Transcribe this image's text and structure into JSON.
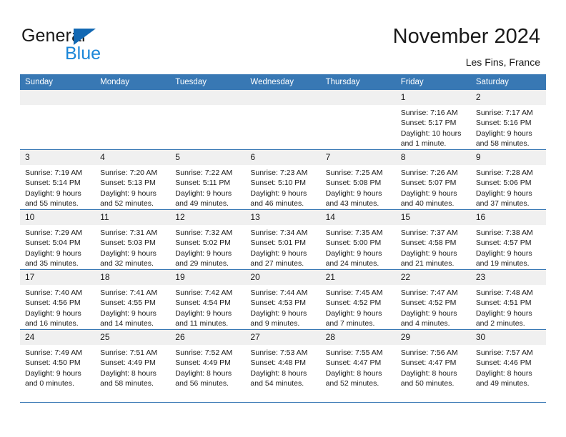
{
  "brand": {
    "name_part1": "General",
    "name_part2": "Blue",
    "triangle_color": "#1268b3",
    "blue_text_color": "#1a86d8"
  },
  "header": {
    "title": "November 2024",
    "subtitle": "Les Fins, France",
    "header_bg_color": "#3878b4",
    "daynum_bg_color": "#f0f0f0"
  },
  "weekday_headers": [
    "Sunday",
    "Monday",
    "Tuesday",
    "Wednesday",
    "Thursday",
    "Friday",
    "Saturday"
  ],
  "weeks": [
    [
      {
        "day": "",
        "empty": true,
        "sunrise": "",
        "sunset": "",
        "daylight_line1": "",
        "daylight_line2": ""
      },
      {
        "day": "",
        "empty": true,
        "sunrise": "",
        "sunset": "",
        "daylight_line1": "",
        "daylight_line2": ""
      },
      {
        "day": "",
        "empty": true,
        "sunrise": "",
        "sunset": "",
        "daylight_line1": "",
        "daylight_line2": ""
      },
      {
        "day": "",
        "empty": true,
        "sunrise": "",
        "sunset": "",
        "daylight_line1": "",
        "daylight_line2": ""
      },
      {
        "day": "",
        "empty": true,
        "sunrise": "",
        "sunset": "",
        "daylight_line1": "",
        "daylight_line2": ""
      },
      {
        "day": "1",
        "sunrise": "Sunrise: 7:16 AM",
        "sunset": "Sunset: 5:17 PM",
        "daylight_line1": "Daylight: 10 hours",
        "daylight_line2": "and 1 minute."
      },
      {
        "day": "2",
        "sunrise": "Sunrise: 7:17 AM",
        "sunset": "Sunset: 5:16 PM",
        "daylight_line1": "Daylight: 9 hours",
        "daylight_line2": "and 58 minutes."
      }
    ],
    [
      {
        "day": "3",
        "sunrise": "Sunrise: 7:19 AM",
        "sunset": "Sunset: 5:14 PM",
        "daylight_line1": "Daylight: 9 hours",
        "daylight_line2": "and 55 minutes."
      },
      {
        "day": "4",
        "sunrise": "Sunrise: 7:20 AM",
        "sunset": "Sunset: 5:13 PM",
        "daylight_line1": "Daylight: 9 hours",
        "daylight_line2": "and 52 minutes."
      },
      {
        "day": "5",
        "sunrise": "Sunrise: 7:22 AM",
        "sunset": "Sunset: 5:11 PM",
        "daylight_line1": "Daylight: 9 hours",
        "daylight_line2": "and 49 minutes."
      },
      {
        "day": "6",
        "sunrise": "Sunrise: 7:23 AM",
        "sunset": "Sunset: 5:10 PM",
        "daylight_line1": "Daylight: 9 hours",
        "daylight_line2": "and 46 minutes."
      },
      {
        "day": "7",
        "sunrise": "Sunrise: 7:25 AM",
        "sunset": "Sunset: 5:08 PM",
        "daylight_line1": "Daylight: 9 hours",
        "daylight_line2": "and 43 minutes."
      },
      {
        "day": "8",
        "sunrise": "Sunrise: 7:26 AM",
        "sunset": "Sunset: 5:07 PM",
        "daylight_line1": "Daylight: 9 hours",
        "daylight_line2": "and 40 minutes."
      },
      {
        "day": "9",
        "sunrise": "Sunrise: 7:28 AM",
        "sunset": "Sunset: 5:06 PM",
        "daylight_line1": "Daylight: 9 hours",
        "daylight_line2": "and 37 minutes."
      }
    ],
    [
      {
        "day": "10",
        "sunrise": "Sunrise: 7:29 AM",
        "sunset": "Sunset: 5:04 PM",
        "daylight_line1": "Daylight: 9 hours",
        "daylight_line2": "and 35 minutes."
      },
      {
        "day": "11",
        "sunrise": "Sunrise: 7:31 AM",
        "sunset": "Sunset: 5:03 PM",
        "daylight_line1": "Daylight: 9 hours",
        "daylight_line2": "and 32 minutes."
      },
      {
        "day": "12",
        "sunrise": "Sunrise: 7:32 AM",
        "sunset": "Sunset: 5:02 PM",
        "daylight_line1": "Daylight: 9 hours",
        "daylight_line2": "and 29 minutes."
      },
      {
        "day": "13",
        "sunrise": "Sunrise: 7:34 AM",
        "sunset": "Sunset: 5:01 PM",
        "daylight_line1": "Daylight: 9 hours",
        "daylight_line2": "and 27 minutes."
      },
      {
        "day": "14",
        "sunrise": "Sunrise: 7:35 AM",
        "sunset": "Sunset: 5:00 PM",
        "daylight_line1": "Daylight: 9 hours",
        "daylight_line2": "and 24 minutes."
      },
      {
        "day": "15",
        "sunrise": "Sunrise: 7:37 AM",
        "sunset": "Sunset: 4:58 PM",
        "daylight_line1": "Daylight: 9 hours",
        "daylight_line2": "and 21 minutes."
      },
      {
        "day": "16",
        "sunrise": "Sunrise: 7:38 AM",
        "sunset": "Sunset: 4:57 PM",
        "daylight_line1": "Daylight: 9 hours",
        "daylight_line2": "and 19 minutes."
      }
    ],
    [
      {
        "day": "17",
        "sunrise": "Sunrise: 7:40 AM",
        "sunset": "Sunset: 4:56 PM",
        "daylight_line1": "Daylight: 9 hours",
        "daylight_line2": "and 16 minutes."
      },
      {
        "day": "18",
        "sunrise": "Sunrise: 7:41 AM",
        "sunset": "Sunset: 4:55 PM",
        "daylight_line1": "Daylight: 9 hours",
        "daylight_line2": "and 14 minutes."
      },
      {
        "day": "19",
        "sunrise": "Sunrise: 7:42 AM",
        "sunset": "Sunset: 4:54 PM",
        "daylight_line1": "Daylight: 9 hours",
        "daylight_line2": "and 11 minutes."
      },
      {
        "day": "20",
        "sunrise": "Sunrise: 7:44 AM",
        "sunset": "Sunset: 4:53 PM",
        "daylight_line1": "Daylight: 9 hours",
        "daylight_line2": "and 9 minutes."
      },
      {
        "day": "21",
        "sunrise": "Sunrise: 7:45 AM",
        "sunset": "Sunset: 4:52 PM",
        "daylight_line1": "Daylight: 9 hours",
        "daylight_line2": "and 7 minutes."
      },
      {
        "day": "22",
        "sunrise": "Sunrise: 7:47 AM",
        "sunset": "Sunset: 4:52 PM",
        "daylight_line1": "Daylight: 9 hours",
        "daylight_line2": "and 4 minutes."
      },
      {
        "day": "23",
        "sunrise": "Sunrise: 7:48 AM",
        "sunset": "Sunset: 4:51 PM",
        "daylight_line1": "Daylight: 9 hours",
        "daylight_line2": "and 2 minutes."
      }
    ],
    [
      {
        "day": "24",
        "sunrise": "Sunrise: 7:49 AM",
        "sunset": "Sunset: 4:50 PM",
        "daylight_line1": "Daylight: 9 hours",
        "daylight_line2": "and 0 minutes."
      },
      {
        "day": "25",
        "sunrise": "Sunrise: 7:51 AM",
        "sunset": "Sunset: 4:49 PM",
        "daylight_line1": "Daylight: 8 hours",
        "daylight_line2": "and 58 minutes."
      },
      {
        "day": "26",
        "sunrise": "Sunrise: 7:52 AM",
        "sunset": "Sunset: 4:49 PM",
        "daylight_line1": "Daylight: 8 hours",
        "daylight_line2": "and 56 minutes."
      },
      {
        "day": "27",
        "sunrise": "Sunrise: 7:53 AM",
        "sunset": "Sunset: 4:48 PM",
        "daylight_line1": "Daylight: 8 hours",
        "daylight_line2": "and 54 minutes."
      },
      {
        "day": "28",
        "sunrise": "Sunrise: 7:55 AM",
        "sunset": "Sunset: 4:47 PM",
        "daylight_line1": "Daylight: 8 hours",
        "daylight_line2": "and 52 minutes."
      },
      {
        "day": "29",
        "sunrise": "Sunrise: 7:56 AM",
        "sunset": "Sunset: 4:47 PM",
        "daylight_line1": "Daylight: 8 hours",
        "daylight_line2": "and 50 minutes."
      },
      {
        "day": "30",
        "sunrise": "Sunrise: 7:57 AM",
        "sunset": "Sunset: 4:46 PM",
        "daylight_line1": "Daylight: 8 hours",
        "daylight_line2": "and 49 minutes."
      }
    ]
  ]
}
